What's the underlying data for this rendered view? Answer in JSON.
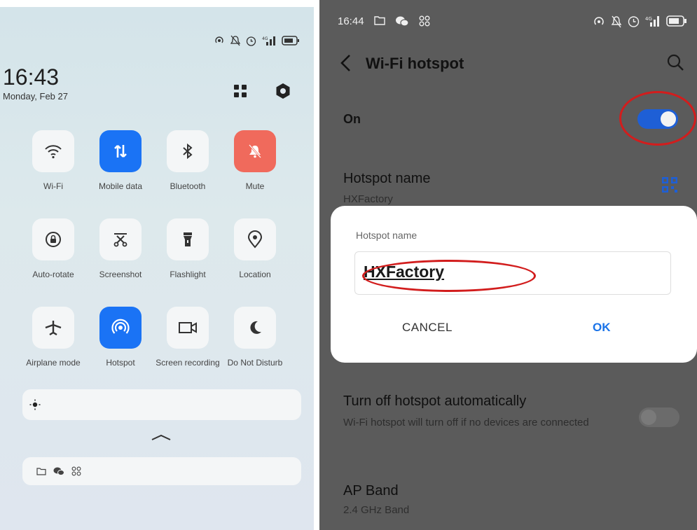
{
  "left_panel": {
    "status_icons": [
      "hotspot-icon",
      "mute-icon",
      "alarm-icon",
      "signal-4g-icon",
      "battery-icon"
    ],
    "time": "16:43",
    "date": "Monday, Feb 27",
    "top_icons": [
      "grid-icon",
      "settings-icon"
    ],
    "tiles": [
      {
        "label": "Wi-Fi",
        "icon": "wifi-icon",
        "state": "off"
      },
      {
        "label": "Mobile data",
        "icon": "mobile-data-icon",
        "state": "on"
      },
      {
        "label": "Bluetooth",
        "icon": "bluetooth-icon",
        "state": "off"
      },
      {
        "label": "Mute",
        "icon": "mute-icon",
        "state": "on-red"
      },
      {
        "label": "Auto-rotate",
        "icon": "auto-rotate-icon",
        "state": "off"
      },
      {
        "label": "Screenshot",
        "icon": "screenshot-icon",
        "state": "off"
      },
      {
        "label": "Flashlight",
        "icon": "flashlight-icon",
        "state": "off"
      },
      {
        "label": "Location",
        "icon": "location-icon",
        "state": "off"
      },
      {
        "label": "Airplane mode",
        "icon": "airplane-icon",
        "state": "off"
      },
      {
        "label": "Hotspot",
        "icon": "hotspot-icon",
        "state": "on"
      },
      {
        "label": "Screen recording",
        "icon": "screen-record-icon",
        "state": "off"
      },
      {
        "label": "Do Not Disturb",
        "icon": "moon-icon",
        "state": "off"
      }
    ],
    "brightness_icon": "brightness-icon",
    "notification_icons": [
      "folder-icon",
      "wechat-icon",
      "apps-icon"
    ]
  },
  "right_panel": {
    "status": {
      "time": "16:44",
      "left_icons": [
        "folder-icon",
        "wechat-icon",
        "apps-icon"
      ],
      "right_icons": [
        "hotspot-icon",
        "mute-icon",
        "alarm-icon",
        "signal-4g-icon",
        "battery-icon"
      ]
    },
    "header": {
      "title": "Wi-Fi hotspot"
    },
    "on_row": {
      "label": "On",
      "toggle_on": true
    },
    "hotspot_name_row": {
      "label": "Hotspot name",
      "value": "HXFactory"
    },
    "dialog": {
      "title": "Hotspot name",
      "input_value": "HXFactory",
      "cancel_label": "CANCEL",
      "ok_label": "OK"
    },
    "turn_off_row": {
      "label": "Turn off hotspot automatically",
      "description": "Wi-Fi hotspot will turn off if no devices are connected",
      "toggle_on": false
    },
    "ap_band_row": {
      "label": "AP Band",
      "value": "2.4 GHz Band"
    }
  },
  "colors": {
    "accent_blue": "#1a73f5",
    "mute_red": "#f06a5c",
    "highlight_red": "#d21d1d",
    "ok_blue": "#1a73e8"
  }
}
